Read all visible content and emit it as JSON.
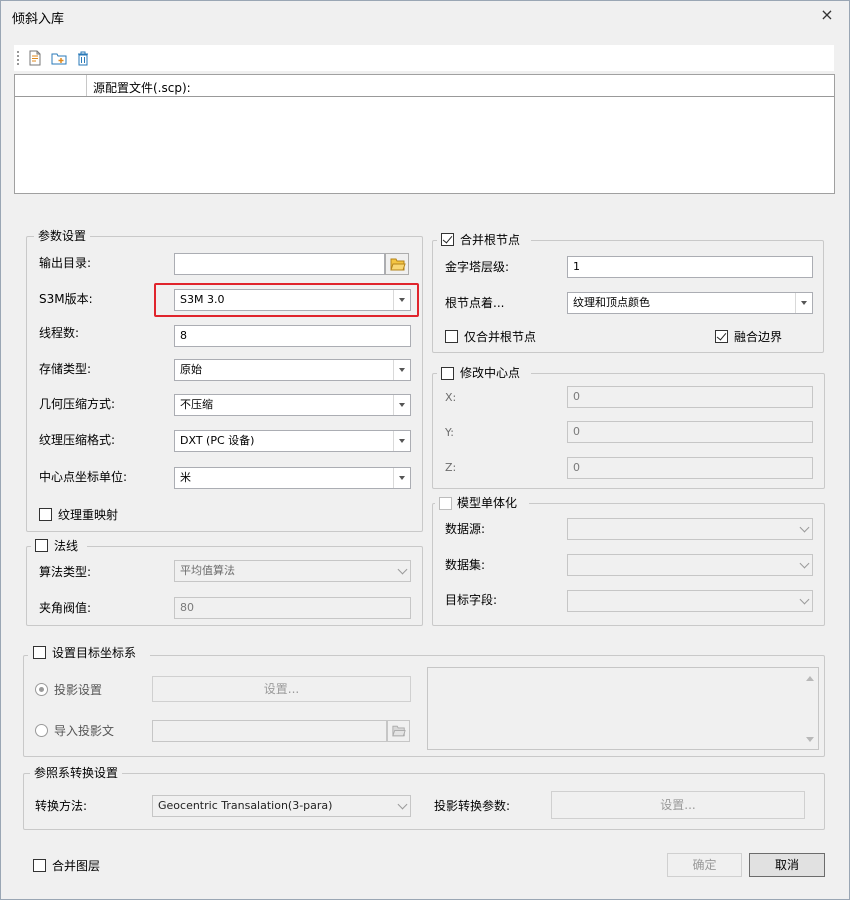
{
  "window": {
    "title": "倾斜入库",
    "close_icon": "×"
  },
  "toolbar": {
    "icons": [
      "add-file-icon",
      "add-folder-icon",
      "delete-icon"
    ]
  },
  "grid": {
    "col_header": "源配置文件(.scp):"
  },
  "params": {
    "group_title": "参数设置",
    "output_dir_label": "输出目录:",
    "output_dir_value": "",
    "s3m_label": "S3M版本:",
    "s3m_value": "S3M 3.0",
    "threads_label": "线程数:",
    "threads_value": "8",
    "storage_label": "存储类型:",
    "storage_value": "原始",
    "geom_label": "几何压缩方式:",
    "geom_value": "不压缩",
    "texture_label": "纹理压缩格式:",
    "texture_value": "DXT (PC 设备)",
    "center_unit_label": "中心点坐标单位:",
    "center_unit_value": "米",
    "remap_label": "纹理重映射",
    "remap_checked": false
  },
  "normals": {
    "title": "法线",
    "checked": false,
    "algo_label": "算法类型:",
    "algo_value": "平均值算法",
    "angle_label": "夹角阀值:",
    "angle_value": "80"
  },
  "merge_root": {
    "title": "合并根节点",
    "checked": true,
    "pyramid_label": "金字塔层级:",
    "pyramid_value": "1",
    "root_color_label": "根节点着...",
    "root_color_value": "纹理和顶点颜色",
    "only_root_label": "仅合并根节点",
    "only_root_checked": false,
    "merge_border_label": "融合边界",
    "merge_border_checked": true
  },
  "center": {
    "title": "修改中心点",
    "checked": false,
    "x_label": "X:",
    "x_value": "0",
    "y_label": "Y:",
    "y_value": "0",
    "z_label": "Z:",
    "z_value": "0"
  },
  "model": {
    "title": "模型单体化",
    "checked": false,
    "datasource_label": "数据源:",
    "dataset_label": "数据集:",
    "field_label": "目标字段:"
  },
  "target_crs": {
    "title": "设置目标坐标系",
    "checked": false,
    "proj_setting_label": "投影设置",
    "setting_button": "设置...",
    "import_label": "导入投影文"
  },
  "ref_transform": {
    "title": "参照系转换设置",
    "method_label": "转换方法:",
    "method_value": "Geocentric Transalation(3-para)",
    "params_label": "投影转换参数:",
    "setting_button": "设置..."
  },
  "footer": {
    "merge_layers_label": "合并图层",
    "merge_layers_checked": false,
    "ok_button": "确定",
    "cancel_button": "取消"
  }
}
